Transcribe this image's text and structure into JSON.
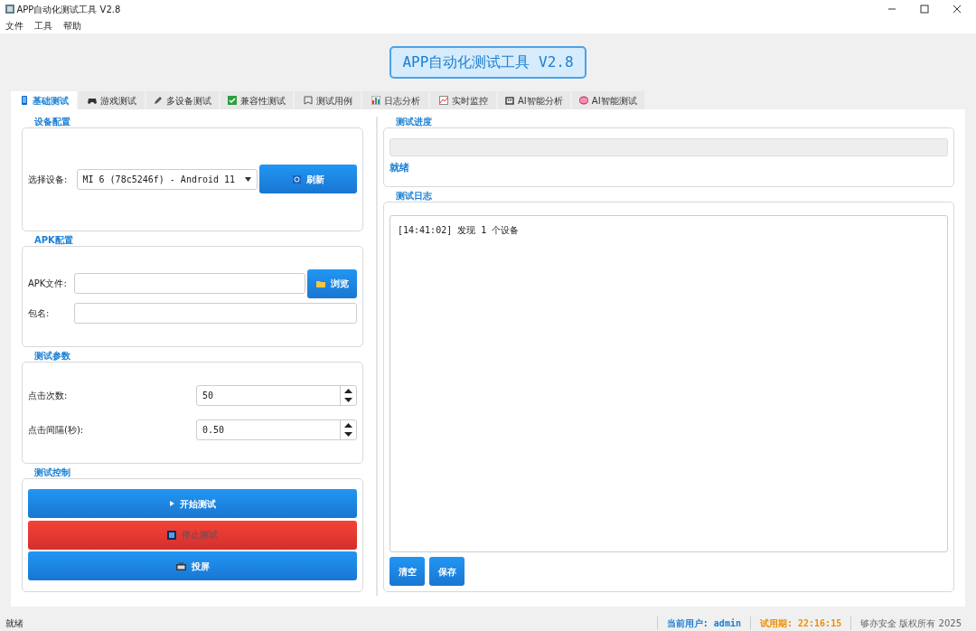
{
  "window": {
    "title": "APP自动化测试工具 V2.8"
  },
  "menu": [
    "文件",
    "工具",
    "帮助"
  ],
  "header": {
    "title": "APP自动化测试工具 V2.8"
  },
  "tabs": [
    {
      "label": "基础测试",
      "selected": true
    },
    {
      "label": "游戏测试",
      "selected": false
    },
    {
      "label": "多设备测试",
      "selected": false
    },
    {
      "label": "兼容性测试",
      "selected": false
    },
    {
      "label": "测试用例",
      "selected": false
    },
    {
      "label": "日志分析",
      "selected": false
    },
    {
      "label": "实时监控",
      "selected": false
    },
    {
      "label": "AI智能分析",
      "selected": false
    },
    {
      "label": "AI智能测试",
      "selected": false
    }
  ],
  "device_config": {
    "title": "设备配置",
    "label": "选择设备:",
    "device": "MI 6 (78c5246f) - Android 11",
    "refresh_button": "刷新"
  },
  "apk_config": {
    "title": "APK配置",
    "file_label": "APK文件:",
    "browse_button": "浏览",
    "package_label": "包名:"
  },
  "params": {
    "title": "测试参数",
    "fields": [
      {
        "label": "点击次数:",
        "value": "50"
      },
      {
        "label": "点击间隔(秒):",
        "value": "0.50"
      }
    ]
  },
  "control": {
    "title": "测试控制",
    "buttons": [
      {
        "label": "开始测试",
        "kind": "start",
        "disabled": false
      },
      {
        "label": "停止测试",
        "kind": "stop",
        "disabled": true
      },
      {
        "label": "投屏",
        "kind": "screen",
        "disabled": false
      }
    ]
  },
  "progress": {
    "title": "测试进度",
    "level": 0,
    "status": "就绪"
  },
  "log": {
    "title": "测试日志",
    "lines": [
      "[14:41:02] 发现 1 个设备"
    ],
    "buttons": [
      "清空",
      "保存"
    ]
  },
  "status_bar": {
    "message": "就绪",
    "user_label": "当前用户: admin",
    "trial_label": "试用期: 22:16:15",
    "copyright": "够亦安全 版权所有 2025"
  }
}
